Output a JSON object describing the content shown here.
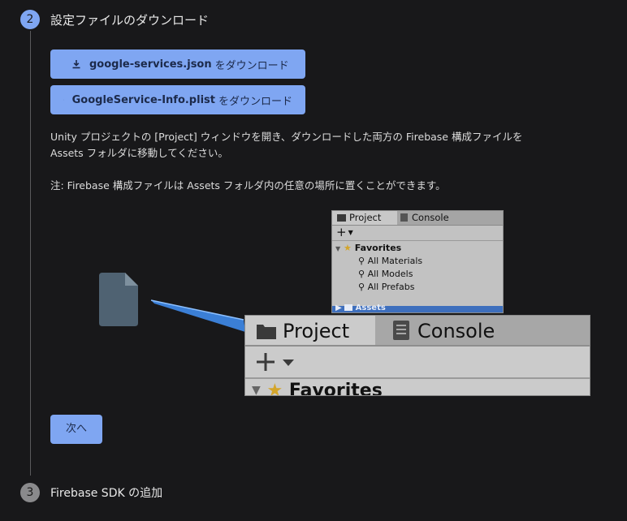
{
  "step2": {
    "number": "2",
    "title": "設定ファイルのダウンロード"
  },
  "buttons": {
    "android": {
      "file": "google-services.json",
      "action": "をダウンロード"
    },
    "ios": {
      "file": "GoogleService-Info.plist",
      "action": "をダウンロード"
    }
  },
  "instructions": {
    "line1": "Unity プロジェクトの [Project] ウィンドウを開き、ダウンロードした両方の Firebase 構成ファイルを",
    "line2": "Assets フォルダに移動してください。",
    "note": "注: Firebase 構成ファイルは Assets フォルダ内の任意の場所に置くことができます。"
  },
  "unity_small": {
    "tabs": [
      "Project",
      "Console"
    ],
    "add": "+",
    "favorites": "Favorites",
    "items": [
      "All Materials",
      "All Models",
      "All Prefabs"
    ],
    "assets": "Assets"
  },
  "unity_zoom": {
    "tabs": [
      "Project",
      "Console"
    ],
    "favorites": "Favorites"
  },
  "next_button": "次へ",
  "step3": {
    "number": "3",
    "title": "Firebase SDK の追加"
  },
  "colors": {
    "accent": "#7fa6f2",
    "background": "#18181a",
    "selection": "#3e6fbd"
  }
}
